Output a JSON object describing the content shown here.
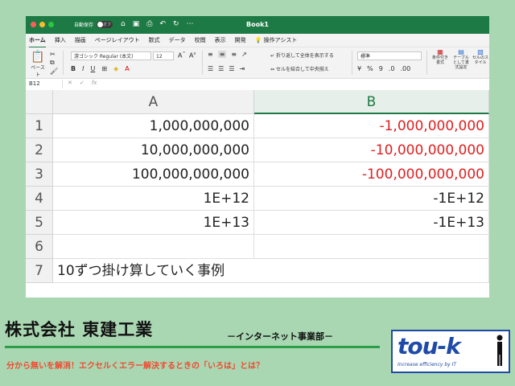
{
  "window": {
    "title": "Book1",
    "autosave_label": "自動保存",
    "autosave_state": "オフ"
  },
  "ribbon_tabs": [
    "ホーム",
    "挿入",
    "描画",
    "ページレイアウト",
    "数式",
    "データ",
    "校閲",
    "表示",
    "開発"
  ],
  "tell_me": "操作アシスト",
  "ribbon": {
    "paste_label": "ペースト",
    "font_name": "游ゴシック Regular (本文)",
    "font_size": "12",
    "wrap_text": "折り返して全体を表示する",
    "merge_center": "セルを結合して中央揃え",
    "number_format": "標準",
    "conditional_formatting": "条件付き書式",
    "format_as_table": "テーブルとして書式設定",
    "cell_styles": "セルのスタイル"
  },
  "formula_bar": {
    "name_box": "B12",
    "fx": "fx",
    "formula": ""
  },
  "columns": [
    "A",
    "B"
  ],
  "rows": [
    {
      "n": "1",
      "a": "1,000,000,000",
      "b": "-1,000,000,000",
      "b_red": true
    },
    {
      "n": "2",
      "a": "10,000,000,000",
      "b": "-10,000,000,000",
      "b_red": true
    },
    {
      "n": "3",
      "a": "100,000,000,000",
      "b": "-100,000,000,000",
      "b_red": true
    },
    {
      "n": "4",
      "a": "1E+12",
      "b": "-1E+12",
      "b_red": false
    },
    {
      "n": "5",
      "a": "1E+13",
      "b": "-1E+13",
      "b_red": false
    },
    {
      "n": "6",
      "a": "",
      "b": "",
      "b_red": false
    },
    {
      "n": "7",
      "a": "10ずつ掛け算していく事例",
      "b": "",
      "b_red": false
    }
  ],
  "banner": {
    "company": "株式会社 東建工業",
    "department": "－インターネット事業部－",
    "tagline": "分から無いを解消！エクセルくエラー解決するときの「いろは」とは？",
    "logo_text": "tou-k",
    "logo_subtext": "Increase efficiency by IT"
  },
  "colors": {
    "excel_green": "#1e7a45",
    "negative_red": "#e02020",
    "background_green": "#a9d7b2",
    "tagline": "#f04a30",
    "logo_blue": "#1f4aa8"
  }
}
